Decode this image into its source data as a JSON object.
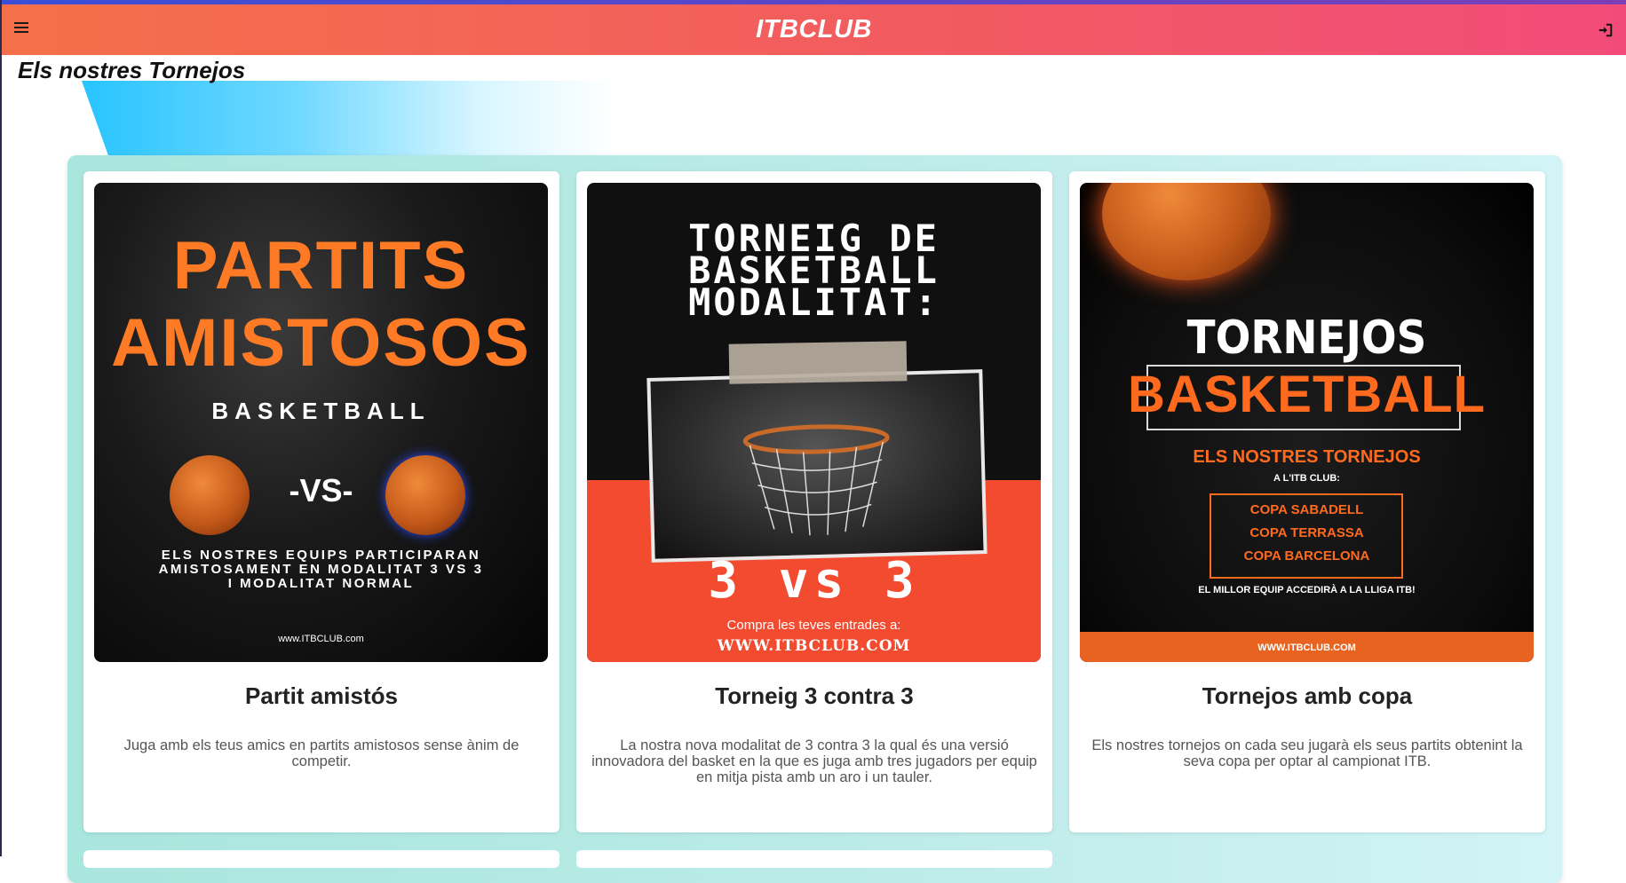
{
  "header": {
    "brand": "ITBCLUB",
    "menu_icon": "hamburger-menu-icon",
    "login_icon": "sign-in-icon"
  },
  "page": {
    "title": "Els nostres Tornejos"
  },
  "colors": {
    "header_left": "#f5704a",
    "header_right": "#f24b7a",
    "accent_orange": "#ff7a24",
    "poster_red": "#f24b30",
    "grid_bg": "#bcebe8"
  },
  "cards": [
    {
      "title": "Partit amistós",
      "description": "Juga amb els teus amics en partits amistosos sense ànim de competir.",
      "poster": {
        "line1": "PARTITS",
        "line2": "AMISTOSOS",
        "sub": "BASKETBALL",
        "vs": "-VS-",
        "text1": "ELS NOSTRES EQUIPS PARTICIPARAN",
        "text2": "AMISTOSAMENT EN MODALITAT 3 VS 3",
        "text3": "I MODALITAT NORMAL",
        "url": "www.ITBCLUB.com"
      }
    },
    {
      "title": "Torneig 3 contra 3",
      "description": "La nostra nova modalitat de 3 contra 3 la qual és una versió innovadora del basket en la que es juga amb tres jugadors per equip en mitja pista amb un aro i un tauler.",
      "poster": {
        "line1": "TORNEIG DE",
        "line2": "BASKETBALL",
        "line3": "MODALITAT:",
        "vs": "3 vs 3",
        "buy": "Compra les teves entrades a:",
        "url": "WWW.ITBCLUB.COM"
      }
    },
    {
      "title": "Tornejos amb copa",
      "description": "Els nostres tornejos on cada seu jugarà els seus partits obtenint la seva copa per optar al campionat ITB.",
      "poster": {
        "line1": "TORNEJOS",
        "line2": "BASKETBALL",
        "heading": "ELS NOSTRES TORNEJOS",
        "sub": "A L'ITB CLUB:",
        "items": [
          "COPA SABADELL",
          "COPA TERRASSA",
          "COPA BARCELONA"
        ],
        "footer_text": "EL MILLOR EQUIP ACCEDIRÀ A LA LLIGA ITB!",
        "url": "WWW.ITBCLUB.COM"
      }
    }
  ]
}
